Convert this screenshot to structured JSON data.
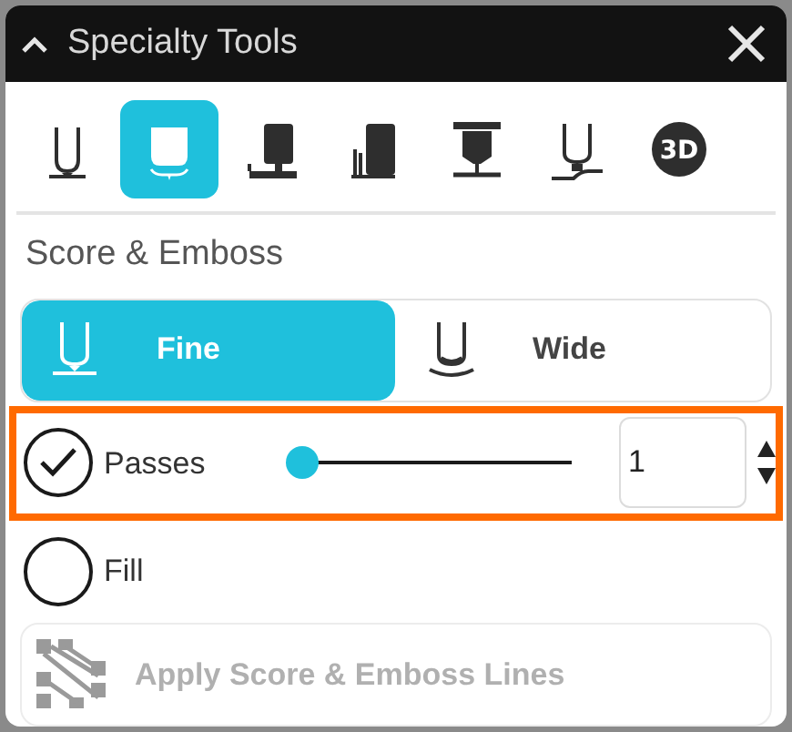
{
  "panel": {
    "title": "Specialty Tools",
    "expanded": true
  },
  "tools": [
    {
      "kind": "score",
      "selected": false
    },
    {
      "kind": "emboss",
      "selected": true
    },
    {
      "kind": "engrave",
      "selected": false
    },
    {
      "kind": "deboss",
      "selected": false
    },
    {
      "kind": "perforate",
      "selected": false
    },
    {
      "kind": "wheel",
      "selected": false
    },
    {
      "kind": "badge",
      "label": "3D",
      "selected": false
    }
  ],
  "section_title": "Score & Emboss",
  "modes": [
    {
      "kind": "fine",
      "label": "Fine",
      "selected": true
    },
    {
      "kind": "wide",
      "label": "Wide",
      "selected": false
    }
  ],
  "options": [
    {
      "label": "Passes",
      "checked": true,
      "highlighted": true,
      "slider": {
        "level": 0
      },
      "value": "1"
    },
    {
      "label": "Fill",
      "checked": false,
      "highlighted": false
    }
  ],
  "apply_button": {
    "label": "Apply Score & Emboss Lines",
    "disabled": true
  }
}
